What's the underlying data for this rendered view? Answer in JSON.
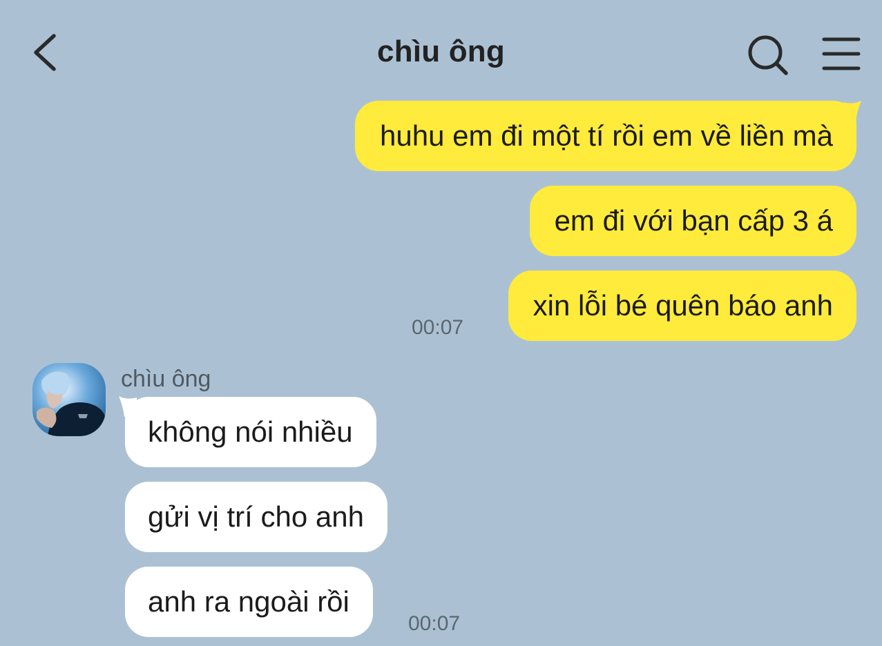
{
  "header": {
    "title": "chìu ông",
    "back_icon": "chevron-left-icon",
    "search_icon": "search-icon",
    "menu_icon": "hamburger-menu-icon"
  },
  "messages_out": [
    {
      "text": "huhu em đi một tí rồi em về liền mà"
    },
    {
      "text": "em đi với bạn cấp 3 á"
    },
    {
      "text": "xin lỗi bé quên báo anh",
      "time": "00:07"
    }
  ],
  "messages_in": {
    "sender": "chìu ông",
    "items": [
      {
        "text": "không nói nhiều"
      },
      {
        "text": "gửi vị trí cho anh"
      },
      {
        "text": "anh ra ngoài rồi",
        "time": "00:07"
      }
    ]
  },
  "colors": {
    "background": "#abc1d3",
    "outgoing_bubble": "#ffeb3b",
    "incoming_bubble": "#ffffff"
  }
}
